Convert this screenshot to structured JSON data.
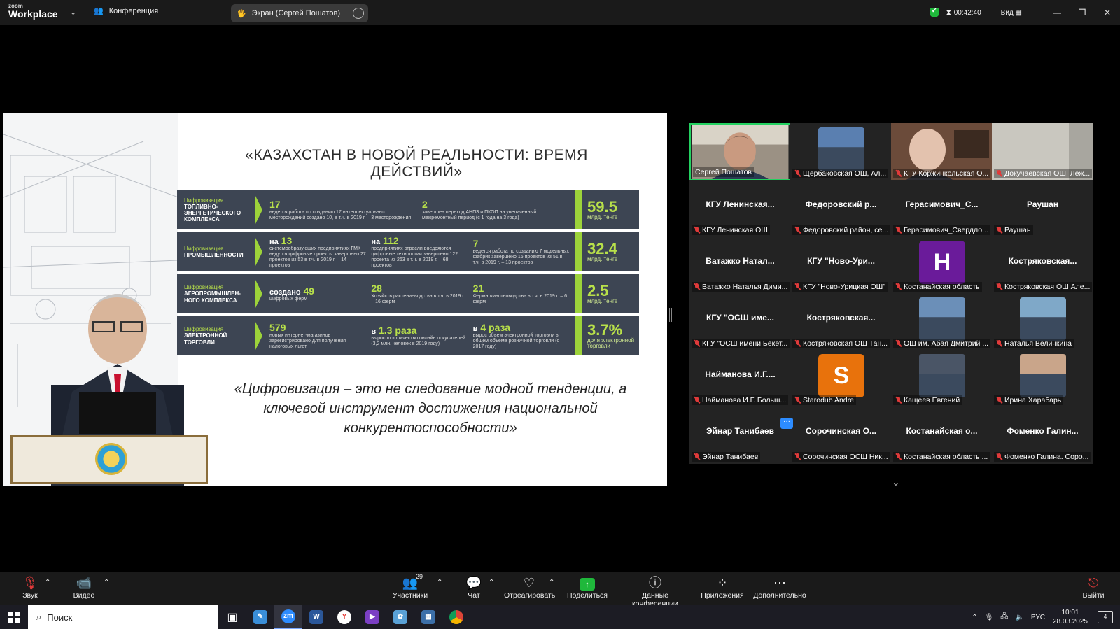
{
  "app": {
    "logo_top": "zoom",
    "logo_bottom": "Workplace",
    "meeting_label": "Конференция",
    "screen_share_label": "Экран (Сергей Пошатов)",
    "timer": "00:42:40",
    "view_label": "Вид"
  },
  "slide": {
    "title": "«КАЗАХСТАН В НОВОЙ РЕАЛЬНОСТИ: ВРЕМЯ ДЕЙСТВИЙ»",
    "rows": [
      {
        "cat_small": "Цифровизация",
        "cat": "топливно-энергетического комплекса",
        "cells": [
          {
            "big": "17",
            "text": "ведется работа по созданию 17 интеллектуальных месторождений создано 10, в т.ч. в 2019 г. – 3 месторождения"
          },
          {
            "big": "2",
            "text": "завершен переход АНПЗ и ПКОП на увеличенный межремонтный период (с 1 года на 3 года)"
          }
        ],
        "total": "59.5",
        "total_unit": "млрд. тенге"
      },
      {
        "cat_small": "Цифровизация",
        "cat": "промышленности",
        "cells": [
          {
            "big_prefix": "на",
            "big": "13",
            "text": "системообразующих предприятиях ГМК ведутся цифровые проекты завершено 27 проектов из 53 в т.ч. в 2019 г. – 14 проектов"
          },
          {
            "big_prefix": "на",
            "big": "112",
            "text": "предприятиях отрасли внедряются цифровые технологии завершено 122 проекта из 263 в т.ч. в 2019 г. – 68 проектов"
          },
          {
            "big": "7",
            "text": "ведется работа по созданию 7 модельных фабрик завершено 16 проектов из 51 в т.ч. в 2019 г. – 13 проектов"
          }
        ],
        "total": "32.4",
        "total_unit": "млрд. тенге"
      },
      {
        "cat_small": "Цифровизация",
        "cat": "агропромышлен-ного комплекса",
        "cells": [
          {
            "big_prefix": "создано",
            "big": "49",
            "text": "цифровых ферм"
          },
          {
            "big": "28",
            "text": "Хозяйств растениеводства в т.ч. в 2019 г. – 16 ферм"
          },
          {
            "big": "21",
            "text": "Ферма животноводства в т.ч. в 2019 г. – 6 ферм"
          }
        ],
        "total": "2.5",
        "total_unit": "млрд. тенге"
      },
      {
        "cat_small": "Цифровизация",
        "cat": "электронной торговли",
        "cells": [
          {
            "big": "579",
            "text": "новых интернет-магазинов зарегистрировано для получения налоговых льгот"
          },
          {
            "big_prefix": "в",
            "big": "1.3 раза",
            "text": "выросло количество онлайн покупателей (3,2 млн. человек в 2019 году)"
          },
          {
            "big_prefix": "в",
            "big": "4 раза",
            "text": "вырос объем электронной торговли в общем объеме розничной торговли (с 2017 году)"
          }
        ],
        "total": "3.7%",
        "total_unit": "доля электронной торговли"
      }
    ],
    "quote": "«Цифровизация – это не следование модной тенденции, а ключевой инструмент достижения национальной конкурентоспособности»"
  },
  "gallery": [
    {
      "name": "",
      "label": "Сергей Пошатов",
      "type": "video",
      "active": true,
      "muted": false
    },
    {
      "name": "",
      "label": "Щербаковская ОШ, Ал...",
      "type": "photo",
      "color": "#5a7fb0",
      "muted": true
    },
    {
      "name": "",
      "label": "КГУ Коржинкольская О...",
      "type": "video2",
      "muted": true
    },
    {
      "name": "",
      "label": "Докучаевская ОШ, Леж...",
      "type": "video3",
      "muted": true
    },
    {
      "name": "КГУ Ленинская...",
      "label": "КГУ Ленинская ОШ",
      "type": "name",
      "muted": true
    },
    {
      "name": "Федоровский р...",
      "label": "Федоровский район, се...",
      "type": "name",
      "muted": true
    },
    {
      "name": "Герасимович_С...",
      "label": "Герасимович_Свердло...",
      "type": "name",
      "muted": true
    },
    {
      "name": "Раушан",
      "label": "Раушан",
      "type": "name",
      "muted": true
    },
    {
      "name": "Ватажко Натал...",
      "label": "Ватажко Наталья Дими...",
      "type": "name",
      "muted": true
    },
    {
      "name": "КГУ \"Ново-Ури...",
      "label": "КГУ \"Ново-Урицкая ОШ\"",
      "type": "name",
      "muted": true
    },
    {
      "name": "",
      "label": "Костанайская область",
      "type": "avatar",
      "letter": "H",
      "color": "#6a1b9a",
      "muted": true
    },
    {
      "name": "Костряковская...",
      "label": "Костряковская ОШ Але...",
      "type": "name",
      "muted": true
    },
    {
      "name": "КГУ \"ОСШ име...",
      "label": "КГУ \"ОСШ имени Бекет...",
      "type": "name",
      "muted": true
    },
    {
      "name": "Костряковская...",
      "label": "Костряковская ОШ Тан...",
      "type": "name",
      "muted": true
    },
    {
      "name": "",
      "label": "ОШ им. Абая Дмитрий ...",
      "type": "photo",
      "color": "#6b8fb8",
      "muted": true
    },
    {
      "name": "",
      "label": "Наталья Величкина",
      "type": "photo",
      "color": "#7fa8c8",
      "muted": true
    },
    {
      "name": "Найманова И.Г....",
      "label": "Найманова И.Г. Больш...",
      "type": "name",
      "muted": true
    },
    {
      "name": "",
      "label": "Starodub Andre",
      "type": "avatar",
      "letter": "S",
      "color": "#e8720c",
      "muted": true
    },
    {
      "name": "",
      "label": "Кащеев Евгений",
      "type": "photo",
      "color": "#4a5566",
      "muted": true
    },
    {
      "name": "",
      "label": "Ирина Харабарь",
      "type": "photo",
      "color": "#c9a58a",
      "muted": true
    },
    {
      "name": "Эйнар Танибаев",
      "label": "Эйнар Танибаев",
      "type": "name",
      "muted": true
    },
    {
      "name": "Сорочинская О...",
      "label": "Сорочинская ОСШ Ник...",
      "type": "name",
      "muted": true
    },
    {
      "name": "Костанайская о...",
      "label": "Костанайская область ...",
      "type": "name",
      "muted": true
    },
    {
      "name": "Фоменко Галин...",
      "label": "Фоменко Галина. Соро...",
      "type": "name",
      "muted": true
    }
  ],
  "toolbar": {
    "audio": "Звук",
    "video": "Видео",
    "participants": "Участники",
    "participants_count": "29",
    "chat": "Чат",
    "react": "Отреагировать",
    "share": "Поделиться",
    "info": "Данные конференции",
    "apps": "Приложения",
    "more": "Дополнительно",
    "leave": "Выйти"
  },
  "taskbar": {
    "search_placeholder": "Поиск",
    "lang": "РУС",
    "time": "10:01",
    "date": "28.03.2025",
    "notifications": "4"
  }
}
